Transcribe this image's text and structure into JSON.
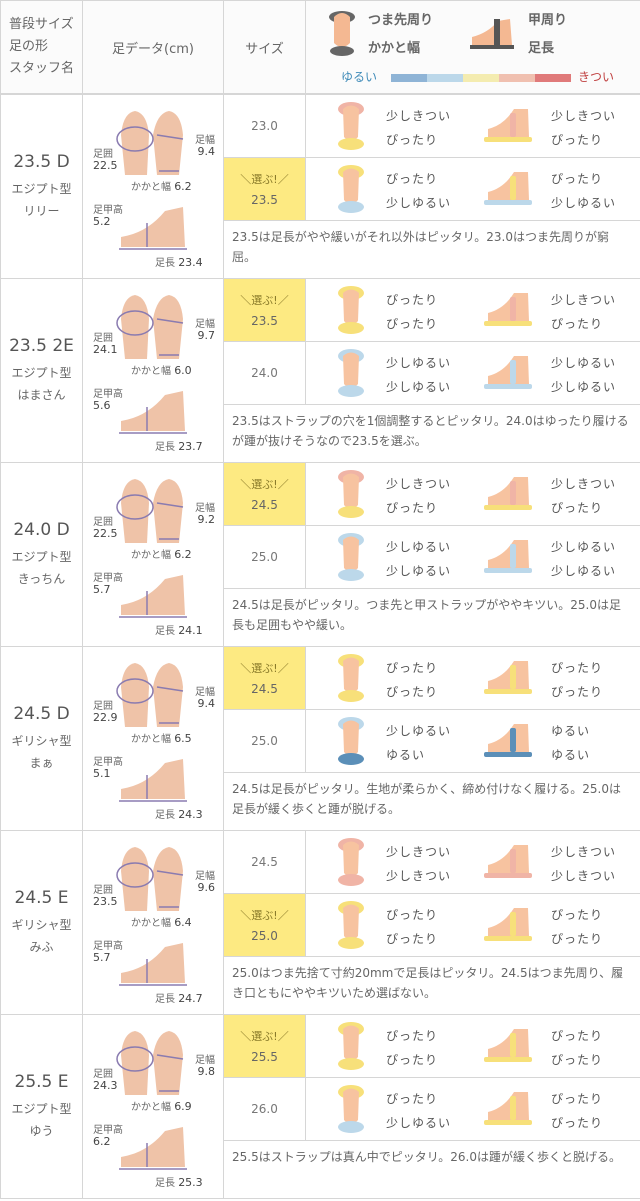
{
  "header": {
    "col1": [
      "普段サイズ",
      "足の形",
      "スタッフ名"
    ],
    "col2": "足データ(cm)",
    "col3": "サイズ",
    "legend": {
      "toe": "つま先周り",
      "heel": "かかと幅",
      "instep": "甲周り",
      "length": "足長",
      "loose": "ゆるい",
      "tight": "きつい",
      "scale_colors": [
        "#8fb4d6",
        "#bcd8ea",
        "#f4ecb0",
        "#f0c0b0",
        "#e07a7a"
      ]
    }
  },
  "labels": {
    "toe_girth": "足囲",
    "width": "足幅",
    "heel": "かかと幅",
    "instep": "足甲高",
    "length": "足長",
    "choose": "＼選ぶ!／"
  },
  "staff": [
    {
      "size": "23.5 D",
      "type": "エジプト型",
      "name": "リリー",
      "toe": "22.5",
      "width": "9.4",
      "heel": "6.2",
      "instep": "5.2",
      "length": "23.4",
      "rows": [
        {
          "size": "23.0",
          "sel": false,
          "a": "少しきつい",
          "b": "ぴったり",
          "c": "少しきつい",
          "d": "ぴったり"
        },
        {
          "size": "23.5",
          "sel": true,
          "a": "ぴったり",
          "b": "少しゆるい",
          "c": "ぴったり",
          "d": "少しゆるい"
        }
      ],
      "comment": "23.5は足長がやや緩いがそれ以外はピッタリ。23.0はつま先周りが窮屈。"
    },
    {
      "size": "23.5 2E",
      "type": "エジプト型",
      "name": "はまさん",
      "toe": "24.1",
      "width": "9.7",
      "heel": "6.0",
      "instep": "5.6",
      "length": "23.7",
      "rows": [
        {
          "size": "23.5",
          "sel": true,
          "a": "ぴったり",
          "b": "ぴったり",
          "c": "少しきつい",
          "d": "ぴったり"
        },
        {
          "size": "24.0",
          "sel": false,
          "a": "少しゆるい",
          "b": "少しゆるい",
          "c": "少しゆるい",
          "d": "少しゆるい"
        }
      ],
      "comment": "23.5はストラップの穴を1個調整するとピッタリ。24.0はゆったり履けるが踵が抜けそうなので23.5を選ぶ。"
    },
    {
      "size": "24.0 D",
      "type": "エジプト型",
      "name": "きっちん",
      "toe": "22.5",
      "width": "9.2",
      "heel": "6.2",
      "instep": "5.7",
      "length": "24.1",
      "rows": [
        {
          "size": "24.5",
          "sel": true,
          "a": "少しきつい",
          "b": "ぴったり",
          "c": "少しきつい",
          "d": "ぴったり"
        },
        {
          "size": "25.0",
          "sel": false,
          "a": "少しゆるい",
          "b": "少しゆるい",
          "c": "少しゆるい",
          "d": "少しゆるい"
        }
      ],
      "comment": "24.5は足長がピッタリ。つま先と甲ストラップがややキツい。25.0は足長も足囲もやや緩い。"
    },
    {
      "size": "24.5 D",
      "type": "ギリシャ型",
      "name": "まぁ",
      "toe": "22.9",
      "width": "9.4",
      "heel": "6.5",
      "instep": "5.1",
      "length": "24.3",
      "rows": [
        {
          "size": "24.5",
          "sel": true,
          "a": "ぴったり",
          "b": "ぴったり",
          "c": "ぴったり",
          "d": "ぴったり"
        },
        {
          "size": "25.0",
          "sel": false,
          "a": "少しゆるい",
          "b": "ゆるい",
          "c": "ゆるい",
          "d": "ゆるい"
        }
      ],
      "comment": "24.5は足長がピッタリ。生地が柔らかく、締め付けなく履ける。25.0は足長が緩く歩くと踵が脱げる。"
    },
    {
      "size": "24.5 E",
      "type": "ギリシャ型",
      "name": "みふ",
      "toe": "23.5",
      "width": "9.6",
      "heel": "6.4",
      "instep": "5.7",
      "length": "24.7",
      "rows": [
        {
          "size": "24.5",
          "sel": false,
          "a": "少しきつい",
          "b": "少しきつい",
          "c": "少しきつい",
          "d": "少しきつい"
        },
        {
          "size": "25.0",
          "sel": true,
          "a": "ぴったり",
          "b": "ぴったり",
          "c": "ぴったり",
          "d": "ぴったり"
        }
      ],
      "comment": "25.0はつま先捨て寸約20mmで足長はピッタリ。24.5はつま先周り、履き口ともにややキツいため選ばない。"
    },
    {
      "size": "25.5 E",
      "type": "エジプト型",
      "name": "ゆう",
      "toe": "24.3",
      "width": "9.8",
      "heel": "6.9",
      "instep": "6.2",
      "length": "25.3",
      "rows": [
        {
          "size": "25.5",
          "sel": true,
          "a": "ぴったり",
          "b": "ぴったり",
          "c": "ぴったり",
          "d": "ぴったり"
        },
        {
          "size": "26.0",
          "sel": false,
          "a": "ぴったり",
          "b": "少しゆるい",
          "c": "ぴったり",
          "d": "ぴったり"
        }
      ],
      "comment": "25.5はストラップは真ん中でピッタリ。26.0は踵が緩く歩くと脱げる。"
    }
  ]
}
